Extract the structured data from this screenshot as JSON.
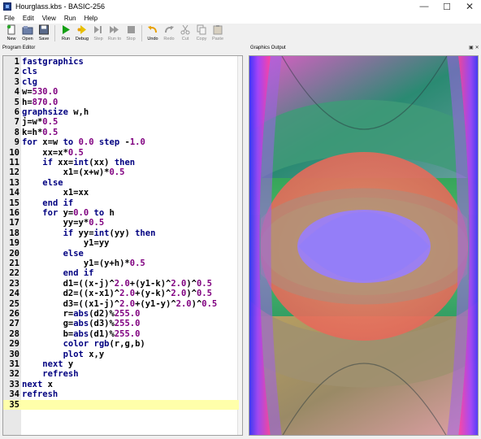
{
  "window": {
    "title": "Hourglass.kbs - BASIC-256"
  },
  "menu": [
    "File",
    "Edit",
    "View",
    "Run",
    "Help"
  ],
  "toolbar": [
    {
      "name": "new",
      "label": "New",
      "icon": "new-file-icon",
      "disabled": false
    },
    {
      "name": "open",
      "label": "Open",
      "icon": "open-folder-icon",
      "disabled": false
    },
    {
      "name": "save",
      "label": "Save",
      "icon": "save-disk-icon",
      "disabled": false
    },
    {
      "name": "run",
      "label": "Run",
      "icon": "play-icon",
      "disabled": false
    },
    {
      "name": "debug",
      "label": "Debug",
      "icon": "debug-icon",
      "disabled": false
    },
    {
      "name": "step",
      "label": "Step",
      "icon": "step-icon",
      "disabled": true
    },
    {
      "name": "run-to",
      "label": "Run to",
      "icon": "run-to-icon",
      "disabled": true
    },
    {
      "name": "stop",
      "label": "Stop",
      "icon": "stop-icon",
      "disabled": true
    },
    {
      "name": "undo",
      "label": "Undo",
      "icon": "undo-icon",
      "disabled": false
    },
    {
      "name": "redo",
      "label": "Redo",
      "icon": "redo-icon",
      "disabled": true
    },
    {
      "name": "cut",
      "label": "Cut",
      "icon": "scissors-icon",
      "disabled": true
    },
    {
      "name": "copy",
      "label": "Copy",
      "icon": "copy-icon",
      "disabled": true
    },
    {
      "name": "paste",
      "label": "Paste",
      "icon": "paste-icon",
      "disabled": true
    }
  ],
  "panels": {
    "editor_title": "Program Editor",
    "graphics_title": "Graphics Output"
  },
  "current_line": 35,
  "code_lines": [
    [
      [
        "kw",
        "fastgraphics"
      ]
    ],
    [
      [
        "kw",
        "cls"
      ]
    ],
    [
      [
        "kw",
        "clg"
      ]
    ],
    [
      [
        "plain",
        "w="
      ],
      [
        "num",
        "530.0"
      ]
    ],
    [
      [
        "plain",
        "h="
      ],
      [
        "num",
        "870.0"
      ]
    ],
    [
      [
        "kw",
        "graphsize"
      ],
      [
        "plain",
        " w,h"
      ]
    ],
    [
      [
        "plain",
        "j=w*"
      ],
      [
        "num",
        "0.5"
      ]
    ],
    [
      [
        "plain",
        "k=h*"
      ],
      [
        "num",
        "0.5"
      ]
    ],
    [
      [
        "kw",
        "for"
      ],
      [
        "plain",
        " x=w "
      ],
      [
        "kw",
        "to"
      ],
      [
        "plain",
        " "
      ],
      [
        "num",
        "0.0"
      ],
      [
        "plain",
        " "
      ],
      [
        "kw",
        "step"
      ],
      [
        "plain",
        " -"
      ],
      [
        "num",
        "1.0"
      ]
    ],
    [
      [
        "plain",
        "    xx=x*"
      ],
      [
        "num",
        "0.5"
      ]
    ],
    [
      [
        "plain",
        "    "
      ],
      [
        "kw",
        "if"
      ],
      [
        "plain",
        " xx="
      ],
      [
        "kw",
        "int"
      ],
      [
        "plain",
        "(xx) "
      ],
      [
        "kw",
        "then"
      ]
    ],
    [
      [
        "plain",
        "        x1=(x+w)*"
      ],
      [
        "num",
        "0.5"
      ]
    ],
    [
      [
        "plain",
        "    "
      ],
      [
        "kw",
        "else"
      ]
    ],
    [
      [
        "plain",
        "        x1=xx"
      ]
    ],
    [
      [
        "plain",
        "    "
      ],
      [
        "kw",
        "end if"
      ]
    ],
    [
      [
        "plain",
        "    "
      ],
      [
        "kw",
        "for"
      ],
      [
        "plain",
        " y="
      ],
      [
        "num",
        "0.0"
      ],
      [
        "plain",
        " "
      ],
      [
        "kw",
        "to"
      ],
      [
        "plain",
        " h"
      ]
    ],
    [
      [
        "plain",
        "        yy=y*"
      ],
      [
        "num",
        "0.5"
      ]
    ],
    [
      [
        "plain",
        "        "
      ],
      [
        "kw",
        "if"
      ],
      [
        "plain",
        " yy="
      ],
      [
        "kw",
        "int"
      ],
      [
        "plain",
        "(yy) "
      ],
      [
        "kw",
        "then"
      ]
    ],
    [
      [
        "plain",
        "            y1=yy"
      ]
    ],
    [
      [
        "plain",
        "        "
      ],
      [
        "kw",
        "else"
      ]
    ],
    [
      [
        "plain",
        "            y1=(y+h)*"
      ],
      [
        "num",
        "0.5"
      ]
    ],
    [
      [
        "plain",
        "        "
      ],
      [
        "kw",
        "end if"
      ]
    ],
    [
      [
        "plain",
        "        d1=((x-j)^"
      ],
      [
        "num",
        "2.0"
      ],
      [
        "plain",
        "+(y1-k)^"
      ],
      [
        "num",
        "2.0"
      ],
      [
        "plain",
        ")^"
      ],
      [
        "num",
        "0.5"
      ]
    ],
    [
      [
        "plain",
        "        d2=((x-x1)^"
      ],
      [
        "num",
        "2.0"
      ],
      [
        "plain",
        "+(y-k)^"
      ],
      [
        "num",
        "2.0"
      ],
      [
        "plain",
        ")^"
      ],
      [
        "num",
        "0.5"
      ]
    ],
    [
      [
        "plain",
        "        d3=((x1-j)^"
      ],
      [
        "num",
        "2.0"
      ],
      [
        "plain",
        "+(y1-y)^"
      ],
      [
        "num",
        "2.0"
      ],
      [
        "plain",
        ")^"
      ],
      [
        "num",
        "0.5"
      ]
    ],
    [
      [
        "plain",
        "        r="
      ],
      [
        "kw",
        "abs"
      ],
      [
        "plain",
        "(d2)%"
      ],
      [
        "num",
        "255.0"
      ]
    ],
    [
      [
        "plain",
        "        g="
      ],
      [
        "kw",
        "abs"
      ],
      [
        "plain",
        "(d3)%"
      ],
      [
        "num",
        "255.0"
      ]
    ],
    [
      [
        "plain",
        "        b="
      ],
      [
        "kw",
        "abs"
      ],
      [
        "plain",
        "(d1)%"
      ],
      [
        "num",
        "255.0"
      ]
    ],
    [
      [
        "plain",
        "        "
      ],
      [
        "kw",
        "color"
      ],
      [
        "plain",
        " "
      ],
      [
        "kw",
        "rgb"
      ],
      [
        "plain",
        "(r,g,b)"
      ]
    ],
    [
      [
        "plain",
        "        "
      ],
      [
        "kw",
        "plot"
      ],
      [
        "plain",
        " x,y"
      ]
    ],
    [
      [
        "plain",
        "    "
      ],
      [
        "kw",
        "next"
      ],
      [
        "plain",
        " y"
      ]
    ],
    [
      [
        "plain",
        "    "
      ],
      [
        "kw",
        "refresh"
      ]
    ],
    [
      [
        "kw",
        "next"
      ],
      [
        "plain",
        " x"
      ]
    ],
    [
      [
        "kw",
        "refresh"
      ]
    ],
    []
  ],
  "colors": {
    "keyword": "#000080",
    "number": "#800080",
    "current_line": "#ffffaa"
  }
}
